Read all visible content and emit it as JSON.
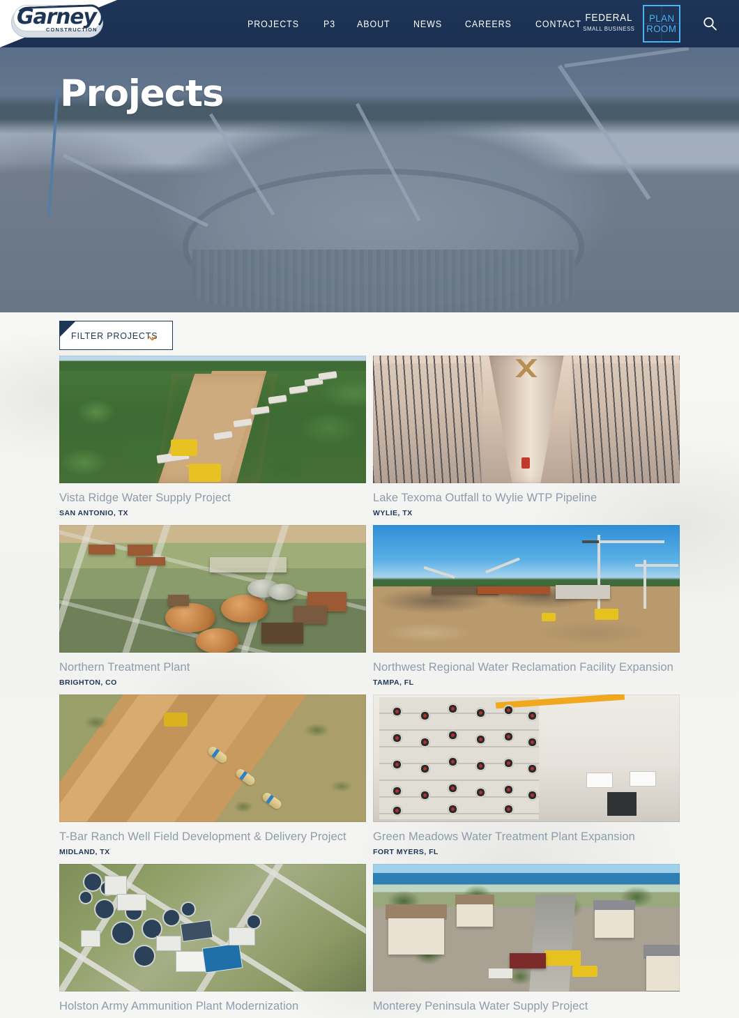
{
  "header": {
    "logo": {
      "name": "Garney",
      "subtitle": "CONSTRUCTION"
    },
    "nav": [
      {
        "label": "PROJECTS"
      },
      {
        "label": "P3"
      },
      {
        "label": "ABOUT"
      },
      {
        "label": "NEWS"
      },
      {
        "label": "CAREERS"
      },
      {
        "label": "CONTACT"
      }
    ],
    "federal": {
      "line1": "FEDERAL",
      "line2": "SMALL BUSINESS"
    },
    "plan_room": {
      "line1": "PLAN",
      "line2": "ROOM"
    },
    "search_label": "Search",
    "accent_color": "#4db3ef",
    "bar_color": "#1d3557"
  },
  "hero": {
    "title": "Projects"
  },
  "filter": {
    "label": "FILTER PROJECTS",
    "chevron_color": "#e07b1f",
    "expanded": false
  },
  "projects": [
    {
      "title": "Vista Ridge Water Supply Project",
      "location": "SAN ANTONIO, TX",
      "thumb": "pipeline-through-forest"
    },
    {
      "title": "Lake Texoma Outfall to Wylie WTP Pipeline",
      "location": "WYLIE, TX",
      "thumb": "large-pipe-in-rebar-trench"
    },
    {
      "title": "Northern Treatment Plant",
      "location": "BRIGHTON, CO",
      "thumb": "treatment-plant-at-dusk"
    },
    {
      "title": "Northwest Regional Water Reclamation Facility Expansion",
      "location": "TAMPA, FL",
      "thumb": "construction-site-with-cranes"
    },
    {
      "title": "T-Bar Ranch Well Field Development & Delivery Project",
      "location": "MIDLAND, TX",
      "thumb": "desert-pipeline-trench"
    },
    {
      "title": "Green Meadows Water Treatment Plant Expansion",
      "location": "FORT MYERS, FL",
      "thumb": "reverse-osmosis-membrane-hall"
    },
    {
      "title": "Holston Army Ammunition Plant Modernization",
      "location": "",
      "thumb": "aerial-treatment-plant"
    },
    {
      "title": "Monterey Peninsula Water Supply Project",
      "location": "",
      "thumb": "coastal-neighborhood-street-work"
    }
  ],
  "colors": {
    "navy": "#1d3557",
    "title_gray": "#8e9bab",
    "page_bg": "#f4f4f2"
  }
}
